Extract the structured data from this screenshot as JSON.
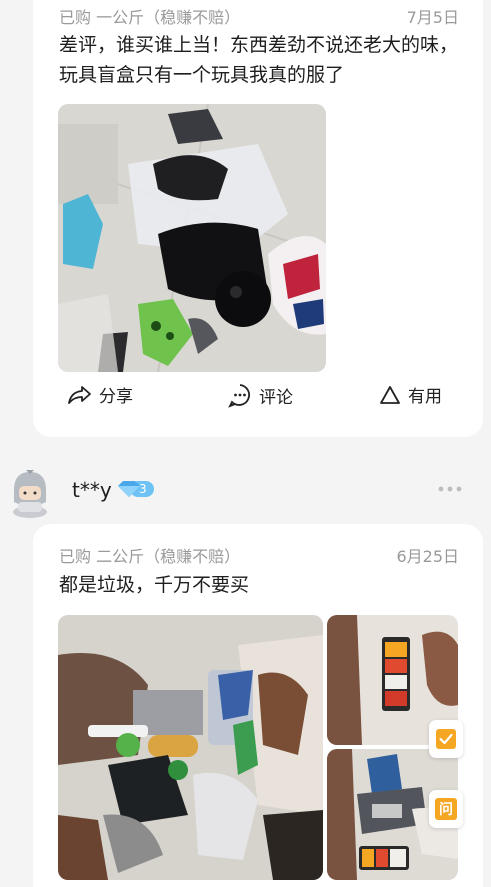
{
  "reviews": [
    {
      "spec": "已购 一公斤（稳赚不赔）",
      "date": "7月5日",
      "text": "差评，谁买谁上当！东西差劲不说还老大的味，玩具盲盒只有一个玩具我真的服了"
    },
    {
      "user": "t**y",
      "vip_level": "3",
      "spec": "已购 二公斤（稳赚不赔）",
      "date": "6月25日",
      "text": "都是垃圾，千万不要买"
    }
  ],
  "actions": {
    "share": "分享",
    "comment": "评论",
    "useful": "有用"
  },
  "floating": {
    "ask": "问"
  },
  "colors": {
    "accent_orange": "#f5a623",
    "vip_blue": "#6ec3f4",
    "meta_gray": "#9a9a9a"
  }
}
